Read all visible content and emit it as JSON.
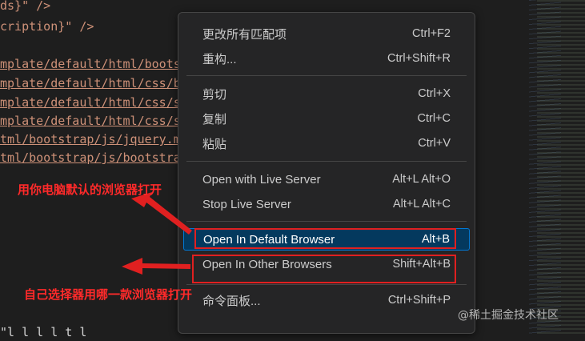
{
  "editor": {
    "lines": [
      "ds}\" />",
      "cription}\" />",
      "",
      "mplate/default/html/boots",
      "mplate/default/html/css/b",
      "mplate/default/html/css/s",
      "mplate/default/html/css/s",
      "tml/bootstrap/js/jquery.m",
      "tml/bootstrap/js/bootstra"
    ],
    "bottom_line": "  \"l      l   l  l    t  l"
  },
  "menu": {
    "items": [
      {
        "label": "更改所有匹配项",
        "shortcut": "Ctrl+F2"
      },
      {
        "label": "重构...",
        "shortcut": "Ctrl+Shift+R"
      },
      {
        "label": "剪切",
        "shortcut": "Ctrl+X"
      },
      {
        "label": "复制",
        "shortcut": "Ctrl+C"
      },
      {
        "label": "粘贴",
        "shortcut": "Ctrl+V"
      },
      {
        "label": "Open with Live Server",
        "shortcut": "Alt+L Alt+O"
      },
      {
        "label": "Stop Live Server",
        "shortcut": "Alt+L Alt+C"
      },
      {
        "label": "Open In Default Browser",
        "shortcut": "Alt+B"
      },
      {
        "label": "Open In Other Browsers",
        "shortcut": "Shift+Alt+B"
      },
      {
        "label": "命令面板...",
        "shortcut": "Ctrl+Shift+P"
      }
    ]
  },
  "annotations": {
    "note1": "用你电脑默认的浏览器打开",
    "note2": "自己选择器用哪一款浏览器打开",
    "color": "#e02020"
  },
  "watermark": "@稀土掘金技术社区",
  "colors": {
    "menu_bg": "#252526",
    "active_bg": "#04395e",
    "editor_bg": "#1e1e1e"
  }
}
